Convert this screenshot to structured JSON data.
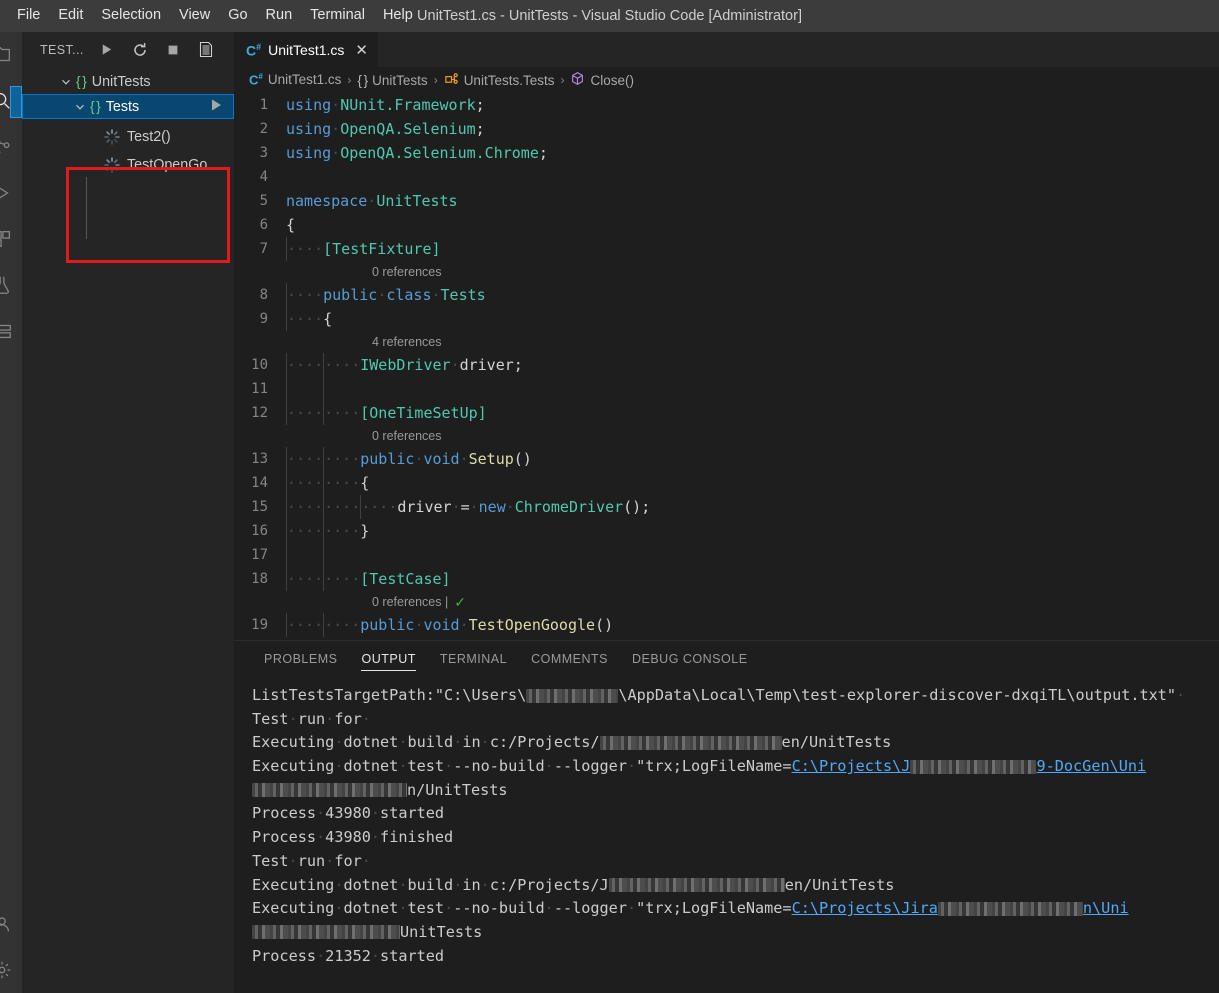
{
  "window": {
    "title": "UnitTest1.cs - UnitTests - Visual Studio Code [Administrator]"
  },
  "menu": {
    "items": [
      {
        "label": "File"
      },
      {
        "label": "Edit"
      },
      {
        "label": "Selection"
      },
      {
        "label": "View"
      },
      {
        "label": "Go"
      },
      {
        "label": "Run"
      },
      {
        "label": "Terminal"
      },
      {
        "label": "Help"
      }
    ]
  },
  "activity_bar": {
    "icons": [
      "explorer-icon",
      "search-icon",
      "source-control-icon",
      "run-and-debug-icon",
      "extensions-icon",
      "testing-icon",
      "remote-explorer-icon",
      "docker-icon",
      "account-icon",
      "settings-gear-icon"
    ]
  },
  "sidebar": {
    "title": "TEST...",
    "toolbar": [
      {
        "name": "run-all-tests-button",
        "glyph": "▶"
      },
      {
        "name": "refresh-tests-button",
        "glyph": "⟳"
      },
      {
        "name": "stop-tests-button",
        "glyph": "■"
      },
      {
        "name": "show-test-output-button",
        "glyph": "▤"
      }
    ],
    "tree": {
      "root": {
        "label": "UnitTests",
        "icon": "namespace-braces-icon",
        "expanded": true
      },
      "suite": {
        "label": "Tests",
        "icon": "namespace-braces-icon",
        "expanded": true,
        "selected": true,
        "run_glyph": "▶"
      },
      "tests": [
        {
          "label": "Test2()",
          "icon": "test-running-spinner-icon"
        },
        {
          "label": "TestOpenGo...",
          "icon": "test-running-spinner-icon"
        }
      ]
    },
    "highlight_color": "#e01b1b"
  },
  "editor": {
    "tab": {
      "label": "UnitTest1.cs",
      "icon": "csharp-file-icon",
      "close_glyph": "✕"
    },
    "breadcrumbs": [
      {
        "label": "UnitTest1.cs",
        "icon": "csharp-file-icon"
      },
      {
        "label": "UnitTests",
        "icon": "namespace-braces-icon"
      },
      {
        "label": "UnitTests.Tests",
        "icon": "class-icon"
      },
      {
        "label": "Close()",
        "icon": "method-cube-icon"
      }
    ],
    "separator": "›",
    "lines": [
      {
        "num": "1",
        "html": "<span class=\"kw\">using</span><span class=\"dot\">·</span><span class=\"ns\">NUnit.Framework</span><span class=\"pl\">;</span>"
      },
      {
        "num": "2",
        "html": "<span class=\"kw\">using</span><span class=\"dot\">·</span><span class=\"ns\">OpenQA.Selenium</span><span class=\"pl\">;</span>"
      },
      {
        "num": "3",
        "html": "<span class=\"kw\">using</span><span class=\"dot\">·</span><span class=\"ns\">OpenQA.Selenium.Chrome</span><span class=\"pl\">;</span>"
      },
      {
        "num": "4",
        "html": ""
      },
      {
        "num": "5",
        "html": "<span class=\"kw\">namespace</span><span class=\"dot\">·</span><span class=\"ns\">UnitTests</span>"
      },
      {
        "num": "6",
        "html": "<span class=\"pl\">{</span>"
      },
      {
        "num": "7",
        "html": "<span class=\"guide\"></span><span class=\"dot\">····</span><span class=\"attr\">[TestFixture]</span>",
        "lens": "0 references"
      },
      {
        "num": "8",
        "html": "<span class=\"guide\"></span><span class=\"dot\">····</span><span class=\"kw\">public</span><span class=\"dot\">·</span><span class=\"kw\">class</span><span class=\"dot\">·</span><span class=\"type\">Tests</span>"
      },
      {
        "num": "9",
        "html": "<span class=\"guide\"></span><span class=\"dot\">····</span><span class=\"pl\">{</span>",
        "lens": "4 references"
      },
      {
        "num": "10",
        "html": "<span class=\"guide\"></span><span class=\"dot\">····</span><span class=\"guide\"></span><span class=\"dot\">····</span><span class=\"type\">IWebDriver</span><span class=\"dot\">·</span><span class=\"pl\">driver;</span>"
      },
      {
        "num": "11",
        "html": "<span class=\"guide\"></span><span class=\"dot\">    </span><span class=\"guide\"></span>"
      },
      {
        "num": "12",
        "html": "<span class=\"guide\"></span><span class=\"dot\">····</span><span class=\"guide\"></span><span class=\"dot\">····</span><span class=\"attr\">[OneTimeSetUp]</span>",
        "lens": "0 references"
      },
      {
        "num": "13",
        "html": "<span class=\"guide\"></span><span class=\"dot\">····</span><span class=\"guide\"></span><span class=\"dot\">····</span><span class=\"kw\">public</span><span class=\"dot\">·</span><span class=\"kw\">void</span><span class=\"dot\">·</span><span class=\"fn\">Setup</span><span class=\"pl\">()</span>"
      },
      {
        "num": "14",
        "html": "<span class=\"guide\"></span><span class=\"dot\">····</span><span class=\"guide\"></span><span class=\"dot\">····</span><span class=\"pl\">{</span>"
      },
      {
        "num": "15",
        "html": "<span class=\"guide\"></span><span class=\"dot\">····</span><span class=\"guide\"></span><span class=\"dot\">····</span><span class=\"guide\"></span><span class=\"dot\">····</span><span class=\"pl\">driver</span><span class=\"dot\">·</span><span class=\"pl\">=</span><span class=\"dot\">·</span><span class=\"kw\">new</span><span class=\"dot\">·</span><span class=\"type\">ChromeDriver</span><span class=\"pl\">();</span>"
      },
      {
        "num": "16",
        "html": "<span class=\"guide\"></span><span class=\"dot\">····</span><span class=\"guide\"></span><span class=\"dot\">····</span><span class=\"pl\">}</span>"
      },
      {
        "num": "17",
        "html": "<span class=\"guide\"></span><span class=\"dot\">    </span><span class=\"guide\"></span>"
      },
      {
        "num": "18",
        "html": "<span class=\"guide\"></span><span class=\"dot\">····</span><span class=\"guide\"></span><span class=\"dot\">····</span><span class=\"attr\">[TestCase]</span>",
        "lens": "0 references |",
        "lens_check": "✓"
      },
      {
        "num": "19",
        "html": "<span class=\"guide\"></span><span class=\"dot\">····</span><span class=\"guide\"></span><span class=\"dot\">····</span><span class=\"kw\">public</span><span class=\"dot\">·</span><span class=\"kw\">void</span><span class=\"dot\">·</span><span class=\"fn\">TestOpenGoogle</span><span class=\"pl\">()</span>"
      }
    ]
  },
  "panel": {
    "tabs": [
      {
        "label": "PROBLEMS",
        "active": false
      },
      {
        "label": "OUTPUT",
        "active": true
      },
      {
        "label": "TERMINAL",
        "active": false
      },
      {
        "label": "COMMENTS",
        "active": false
      },
      {
        "label": "DEBUG CONSOLE",
        "active": false
      }
    ],
    "output_lines": [
      {
        "html": "ListTestsTargetPath:\"C:\\Users\\<span class=\"redact\" style=\"width:92px;height:14px\"></span>\\AppData\\Local\\Temp\\test-explorer-discover-dxqiTL\\output.txt\"<span class=\"dot\">·</span>"
      },
      {
        "html": "Test<span class=\"dot\">·</span>run<span class=\"dot\">·</span>for<span class=\"dot\">·</span>"
      },
      {
        "html": "Executing<span class=\"dot\">·</span>dotnet<span class=\"dot\">·</span>build<span class=\"dot\">·</span>in<span class=\"dot\">·</span>c:/Projects/<span class=\"redact\" style=\"width:182px;height:14px\"></span>en/UnitTests"
      },
      {
        "html": "Executing<span class=\"dot\">·</span>dotnet<span class=\"dot\">·</span>test<span class=\"dot\">·</span>--no-build<span class=\"dot\">·</span>--logger<span class=\"dot\">·</span>\"trx;LogFileName=<span class=\"link\">C:\\Projects\\J</span><span class=\"redact\" style=\"width:126px;height:14px\"></span><span class=\"link\">9-DocGen\\Uni</span>"
      },
      {
        "html": "<span class=\"redact\" style=\"width:155px;height:14px\"></span>n/UnitTests"
      },
      {
        "html": "Process<span class=\"dot\">·</span>43980<span class=\"dot\">·</span>started"
      },
      {
        "html": "Process<span class=\"dot\">·</span>43980<span class=\"dot\">·</span>finished"
      },
      {
        "html": "Test<span class=\"dot\">·</span>run<span class=\"dot\">·</span>for<span class=\"dot\">·</span>"
      },
      {
        "html": "Executing<span class=\"dot\">·</span>dotnet<span class=\"dot\">·</span>build<span class=\"dot\">·</span>in<span class=\"dot\">·</span>c:/Projects/J<span class=\"redact\" style=\"width:176px;height:14px\"></span>en/UnitTests"
      },
      {
        "html": "Executing<span class=\"dot\">·</span>dotnet<span class=\"dot\">·</span>test<span class=\"dot\">·</span>--no-build<span class=\"dot\">·</span>--logger<span class=\"dot\">·</span>\"trx;LogFileName=<span class=\"link\">C:\\Projects\\Jira</span><span class=\"redact\" style=\"width:145px;height:14px\"></span><span class=\"link\">n\\Uni</span>"
      },
      {
        "html": "<span class=\"redact\" style=\"width:148px;height:14px\"></span>UnitTests"
      },
      {
        "html": "Process<span class=\"dot\">·</span>21352<span class=\"dot\">·</span>started"
      }
    ]
  },
  "colors": {
    "titlebar_bg": "#3c3c3c",
    "sidebar_bg": "#252526",
    "editor_bg": "#1e1e1e",
    "selection_blue": "#094771",
    "accent_blue": "#007acc",
    "highlight_red": "#e01b1b"
  }
}
